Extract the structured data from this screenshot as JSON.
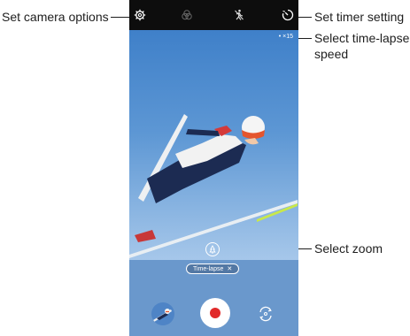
{
  "annotations": {
    "camera_options": "Set camera options",
    "timer_setting": "Set timer setting",
    "timelapse_speed_line1": "Select time-lapse",
    "timelapse_speed_line2": "speed",
    "zoom": "Select zoom"
  },
  "camera": {
    "top_icons": [
      "gear-icon",
      "filter-icon",
      "motion-icon",
      "timer-icon"
    ],
    "speed_value": "• ×15",
    "mode_chip_label": "Time-lapse",
    "mode_chip_close": "✕",
    "record_color": "#e12a2a",
    "sky_color": "#5d97d4"
  }
}
